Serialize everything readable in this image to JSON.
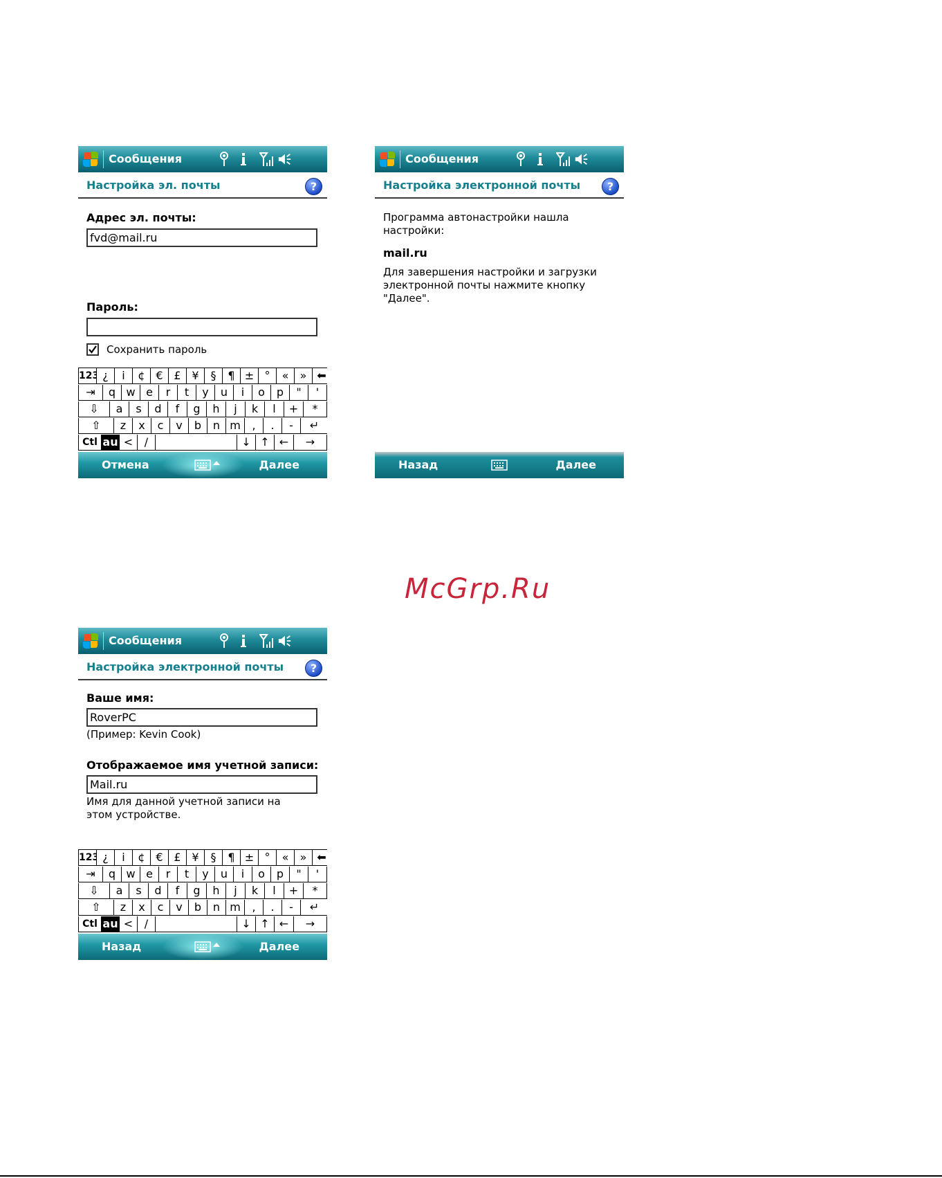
{
  "watermark": "McGrp.Ru",
  "status_icons": [
    "connectivity-icon",
    "notification-icon",
    "signal-strength-icon",
    "volume-icon"
  ],
  "colors": {
    "accent": "#17808e",
    "titlebar": "#1e8a98",
    "watermark": "#c8253a"
  },
  "keyboard": {
    "row1": [
      "123",
      "¿",
      "i",
      "¢",
      "€",
      "£",
      "¥",
      "§",
      "¶",
      "±",
      "°",
      "«",
      "»",
      "⬅"
    ],
    "row2": [
      "⇥",
      "q",
      "w",
      "e",
      "r",
      "t",
      "y",
      "u",
      "i",
      "o",
      "p",
      "\"",
      "'"
    ],
    "row3": [
      "⇩",
      "a",
      "s",
      "d",
      "f",
      "g",
      "h",
      "j",
      "k",
      "l",
      "+",
      "*"
    ],
    "row4": [
      "⇧",
      "z",
      "x",
      "c",
      "v",
      "b",
      "n",
      "m",
      ",",
      ".",
      "-",
      "↵"
    ],
    "row5": [
      "Ctl",
      "au",
      "<",
      "/",
      "",
      "↓",
      "↑",
      "←",
      "→"
    ]
  },
  "screens": [
    {
      "app_title": "Сообщения",
      "heading": "Настройка эл. почты",
      "help": "?",
      "email_label": "Адрес эл. почты:",
      "email_value": "fvd@mail.ru",
      "password_label": "Пароль:",
      "password_value": "",
      "save_password_label": "Сохранить пароль",
      "save_password_checked": true,
      "left_softkey": "Отмена",
      "right_softkey": "Далее"
    },
    {
      "app_title": "Сообщения",
      "heading": "Настройка электронной почты",
      "help": "?",
      "intro": "Программа автонастройки нашла настройки:",
      "provider": "mail.ru",
      "instructions": "Для завершения настройки и загрузки электронной почты нажмите кнопку \"Далее\".",
      "left_softkey": "Назад",
      "right_softkey": "Далее"
    },
    {
      "app_title": "Сообщения",
      "heading": "Настройка электронной почты",
      "help": "?",
      "name_label": "Ваше имя:",
      "name_value": "RoverPC",
      "name_hint": "(Пример: Kevin Cook)",
      "display_label": "Отображаемое имя учетной записи:",
      "display_value": "Mail.ru",
      "display_hint": "Имя для данной учетной записи на этом устройстве.",
      "left_softkey": "Назад",
      "right_softkey": "Далее"
    }
  ]
}
